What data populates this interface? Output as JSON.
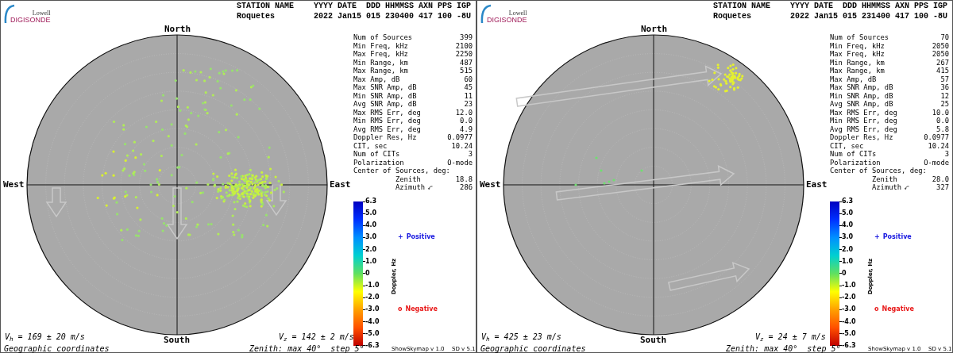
{
  "panels": [
    {
      "logo": {
        "top": "Lowell",
        "bottom": "DIGISONDE"
      },
      "header": {
        "station_label": "STATION NAME",
        "columns_label": "YYYY DATE  DDD HHMMSS AXN PPS IGP",
        "station": "Roquetes",
        "values": "2022 Jan15 015 230400 417 100 -8U"
      },
      "compass": {
        "north": "North",
        "south": "South",
        "west": "West",
        "east": "East"
      },
      "stats": [
        {
          "kind": "row",
          "label": "Num of Sources",
          "value": "399"
        },
        {
          "kind": "row",
          "label": "Min Freq, kHz",
          "value": "2100"
        },
        {
          "kind": "row",
          "label": "Max Freq, kHz",
          "value": "2250"
        },
        {
          "kind": "row",
          "label": "Min Range, km",
          "value": "487"
        },
        {
          "kind": "row",
          "label": "Max Range, km",
          "value": "515"
        },
        {
          "kind": "row",
          "label": "Max Amp, dB",
          "value": "60"
        },
        {
          "kind": "row",
          "label": "Max SNR Amp, dB",
          "value": "45"
        },
        {
          "kind": "row",
          "label": "Min SNR Amp, dB",
          "value": "11"
        },
        {
          "kind": "row",
          "label": "Avg SNR Amp, dB",
          "value": "23"
        },
        {
          "kind": "row",
          "label": "Max RMS Err, deg",
          "value": "12.0"
        },
        {
          "kind": "row",
          "label": "Min RMS Err, deg",
          "value": "0.0"
        },
        {
          "kind": "row",
          "label": "Avg RMS Err, deg",
          "value": "4.9"
        },
        {
          "kind": "row",
          "label": "Doppler Res, Hz",
          "value": "0.0977"
        },
        {
          "kind": "row",
          "label": "CIT, sec",
          "value": "10.24"
        },
        {
          "kind": "row",
          "label": "Num of CITs",
          "value": "3"
        },
        {
          "kind": "row",
          "label": "Polarization",
          "value": "O-mode"
        },
        {
          "kind": "heading",
          "label": "Center of Sources, deg:"
        },
        {
          "kind": "sub",
          "label": "Zenith",
          "value": "18.8"
        },
        {
          "kind": "sub-arrow",
          "label": "Azimuth",
          "value": "286"
        }
      ],
      "colorbar": {
        "ticks": [
          "6.3",
          "5.0",
          "4.0",
          "3.0",
          "2.0",
          "1.0",
          "0",
          "-1.0",
          "-2.0",
          "-3.0",
          "-4.0",
          "-5.0",
          "-6.3"
        ],
        "axis_label": "Doppler, Hz"
      },
      "legend": [
        {
          "marker": "+",
          "label": "Positive",
          "color": "#1818e0"
        },
        {
          "marker": "o",
          "label": "Negative",
          "color": "#e81818"
        }
      ],
      "footer": {
        "vh": "V$_{h}$ = 169 ± 20 m/s",
        "vz": "V$_{z}$ = 142 ± 2 m/s",
        "coords": "Geographic coordinates",
        "zenith": "Zenith: max 40°  step 5°",
        "app": "ShowSkymap v 1.0",
        "sd": "SD v 5.1"
      }
    },
    {
      "logo": {
        "top": "Lowell",
        "bottom": "DIGISONDE"
      },
      "header": {
        "station_label": "STATION NAME",
        "columns_label": "YYYY DATE  DDD HHMMSS AXN PPS IGP",
        "station": "Roquetes",
        "values": "2022 Jan15 015 231400 417 100 -8U"
      },
      "compass": {
        "north": "North",
        "south": "South",
        "west": "West",
        "east": "East"
      },
      "stats": [
        {
          "kind": "row",
          "label": "Num of Sources",
          "value": "70"
        },
        {
          "kind": "row",
          "label": "Min Freq, kHz",
          "value": "2050"
        },
        {
          "kind": "row",
          "label": "Max Freq, kHz",
          "value": "2050"
        },
        {
          "kind": "row",
          "label": "Min Range, km",
          "value": "267"
        },
        {
          "kind": "row",
          "label": "Max Range, km",
          "value": "415"
        },
        {
          "kind": "row",
          "label": "Max Amp, dB",
          "value": "57"
        },
        {
          "kind": "row",
          "label": "Max SNR Amp, dB",
          "value": "36"
        },
        {
          "kind": "row",
          "label": "Min SNR Amp, dB",
          "value": "12"
        },
        {
          "kind": "row",
          "label": "Avg SNR Amp, dB",
          "value": "25"
        },
        {
          "kind": "row",
          "label": "Max RMS Err, deg",
          "value": "10.0"
        },
        {
          "kind": "row",
          "label": "Min RMS Err, deg",
          "value": "0.0"
        },
        {
          "kind": "row",
          "label": "Avg RMS Err, deg",
          "value": "5.8"
        },
        {
          "kind": "row",
          "label": "Doppler Res, Hz",
          "value": "0.0977"
        },
        {
          "kind": "row",
          "label": "CIT, sec",
          "value": "10.24"
        },
        {
          "kind": "row",
          "label": "Num of CITs",
          "value": "3"
        },
        {
          "kind": "row",
          "label": "Polarization",
          "value": "O-mode"
        },
        {
          "kind": "heading",
          "label": "Center of Sources, deg:"
        },
        {
          "kind": "sub",
          "label": "Zenith",
          "value": "28.0"
        },
        {
          "kind": "sub-arrow",
          "label": "Azimuth",
          "value": "327"
        }
      ],
      "colorbar": {
        "ticks": [
          "6.3",
          "5.0",
          "4.0",
          "3.0",
          "2.0",
          "1.0",
          "0",
          "-1.0",
          "-2.0",
          "-3.0",
          "-4.0",
          "-5.0",
          "-6.3"
        ],
        "axis_label": "Doppler, Hz"
      },
      "legend": [
        {
          "marker": "+",
          "label": "Positive",
          "color": "#1818e0"
        },
        {
          "marker": "o",
          "label": "Negative",
          "color": "#e81818"
        }
      ],
      "footer": {
        "vh": "V$_{h}$ = 425 ± 23 m/s",
        "vz": "V$_{z}$ = 24 ± 7 m/s",
        "coords": "Geographic coordinates",
        "zenith": "Zenith: max 40°  step 5°",
        "app": "ShowSkymap v 1.0",
        "sd": "SD v 5.1"
      }
    }
  ]
}
